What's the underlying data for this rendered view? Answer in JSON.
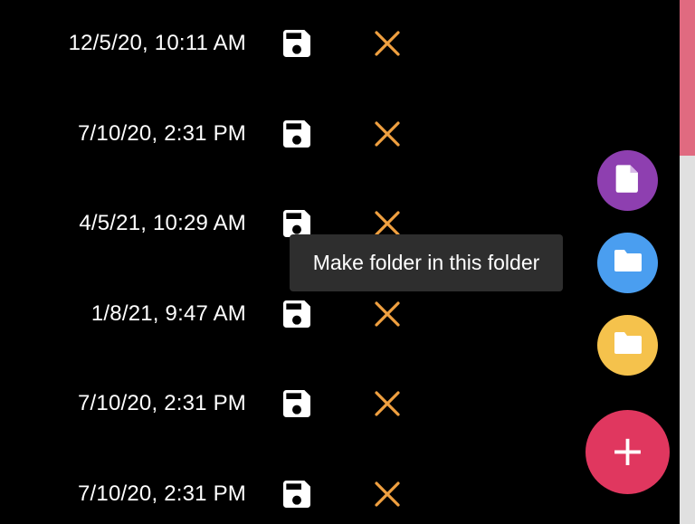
{
  "rows": [
    {
      "date": "12/5/20, 10:11 AM"
    },
    {
      "date": "7/10/20, 2:31 PM"
    },
    {
      "date": "4/5/21, 10:29 AM"
    },
    {
      "date": "1/8/21, 9:47 AM"
    },
    {
      "date": "7/10/20, 2:31 PM"
    },
    {
      "date": "7/10/20, 2:31 PM"
    }
  ],
  "icons": {
    "save": "floppy-disk-icon",
    "delete": "close-x-icon",
    "file": "file-icon",
    "folder": "folder-icon",
    "add": "plus-icon"
  },
  "tooltip": {
    "text": "Make folder in this folder"
  },
  "fab": {
    "add_label": "+"
  },
  "colors": {
    "background": "#000000",
    "text": "#ffffff",
    "delete_orange": "#f0a040",
    "fab_purple": "#8e3fb0",
    "fab_blue": "#4a9ef0",
    "fab_yellow": "#f5c24c",
    "fab_pink": "#e0375f",
    "tooltip_bg": "#2e2e2e",
    "scroll_thumb": "#e06a80",
    "scroll_track": "#e0e0e0"
  }
}
